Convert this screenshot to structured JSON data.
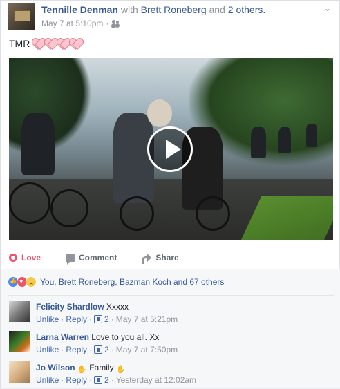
{
  "post": {
    "author": "Tennille Denman",
    "with_word": "with",
    "tagged_friend": "Brett Roneberg",
    "and_word": "and",
    "others": "2 others.",
    "timestamp": "May 7 at 5:10pm",
    "privacy_separator": "·",
    "text": "TMR",
    "hearts_count": 4
  },
  "video": {
    "state": "paused",
    "icon": "play-icon"
  },
  "actions": {
    "love_label": "Love",
    "comment_label": "Comment",
    "share_label": "Share"
  },
  "reactions": {
    "summary": "You, Brett Roneberg, Bazman Koch and 67 others",
    "icons": [
      "like-icon",
      "love-icon",
      "sad-icon"
    ]
  },
  "comments": [
    {
      "name": "Felicity Shardlow",
      "text": "Xxxxx",
      "unlike": "Unlike",
      "reply": "Reply",
      "likes": "2",
      "time": "May 7 at 5:21pm"
    },
    {
      "name": "Larna Warren",
      "text": "Love to you all. Xx",
      "unlike": "Unlike",
      "reply": "Reply",
      "likes": "2",
      "time": "May 7 at 7:50pm"
    },
    {
      "name": "Jo Wilson",
      "text": "Family",
      "unlike": "Unlike",
      "reply": "Reply",
      "likes": "2",
      "time": "Yesterday at 12:02am"
    }
  ],
  "colors": {
    "link": "#365899",
    "love": "#f25268",
    "meta": "#90949c"
  }
}
